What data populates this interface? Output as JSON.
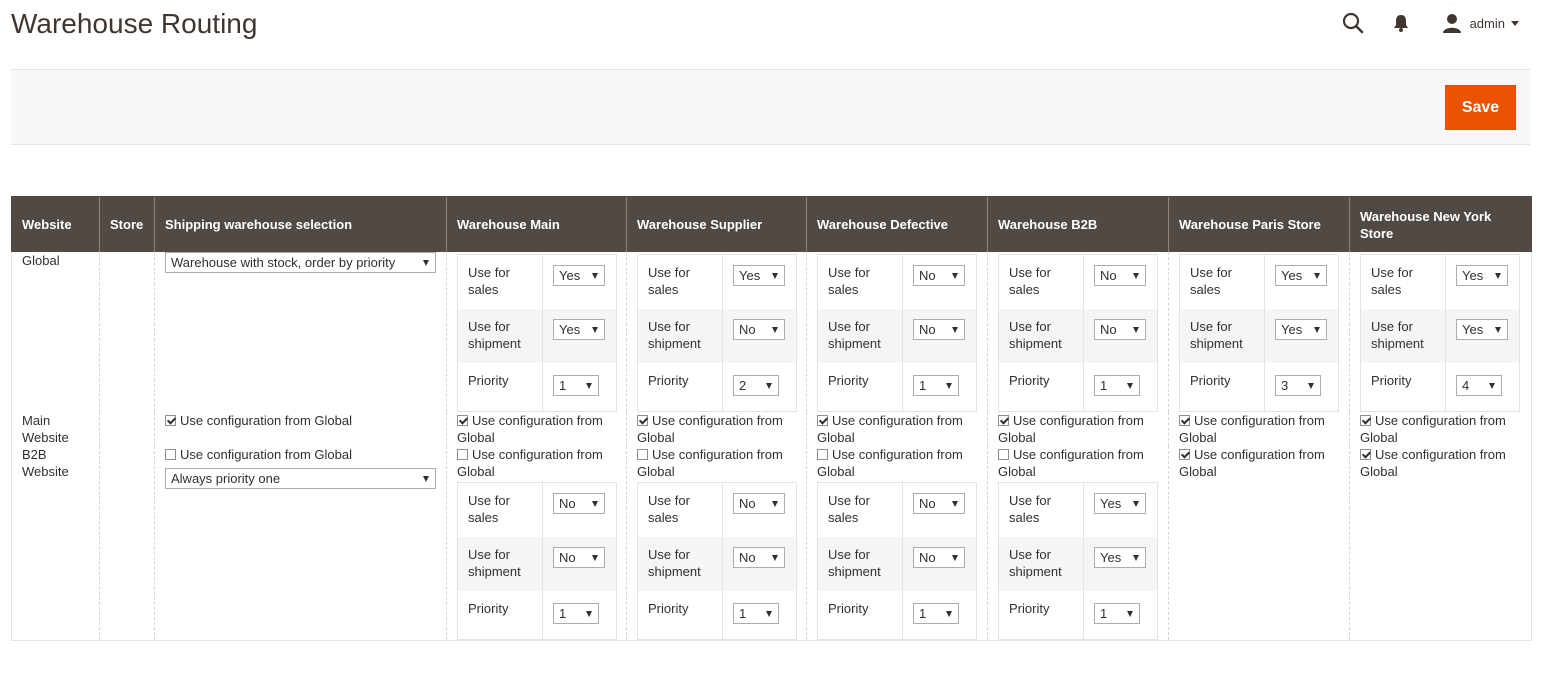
{
  "page": {
    "title": "Warehouse Routing"
  },
  "header": {
    "user": "admin"
  },
  "actions": {
    "save_label": "Save"
  },
  "labels": {
    "use_for_sales": "Use for sales",
    "use_for_shipment": "Use for shipment",
    "priority": "Priority",
    "use_config_global": "Use configuration from Global"
  },
  "columns": [
    "Website",
    "Store",
    "Shipping warehouse selection",
    "Warehouse Main",
    "Warehouse Supplier",
    "Warehouse Defective",
    "Warehouse B2B",
    "Warehouse Paris Store",
    "Warehouse New York Store"
  ],
  "rows": [
    {
      "website": "Global",
      "store": "",
      "shipping": {
        "use_global": null,
        "value": "Warehouse with stock, order by priority"
      },
      "warehouses": [
        {
          "use_global": null,
          "sales": "Yes",
          "shipment": "Yes",
          "priority": "1"
        },
        {
          "use_global": null,
          "sales": "Yes",
          "shipment": "No",
          "priority": "2"
        },
        {
          "use_global": null,
          "sales": "No",
          "shipment": "No",
          "priority": "1"
        },
        {
          "use_global": null,
          "sales": "No",
          "shipment": "No",
          "priority": "1"
        },
        {
          "use_global": null,
          "sales": "Yes",
          "shipment": "Yes",
          "priority": "3"
        },
        {
          "use_global": null,
          "sales": "Yes",
          "shipment": "Yes",
          "priority": "4"
        }
      ]
    },
    {
      "website": "Main Website",
      "store": "",
      "shipping": {
        "use_global": true,
        "value": null
      },
      "warehouses": [
        {
          "use_global": true
        },
        {
          "use_global": true
        },
        {
          "use_global": true
        },
        {
          "use_global": true
        },
        {
          "use_global": true
        },
        {
          "use_global": true
        }
      ]
    },
    {
      "website": "B2B Website",
      "store": "",
      "shipping": {
        "use_global": false,
        "value": "Always priority one"
      },
      "warehouses": [
        {
          "use_global": false,
          "sales": "No",
          "shipment": "No",
          "priority": "1"
        },
        {
          "use_global": false,
          "sales": "No",
          "shipment": "No",
          "priority": "1"
        },
        {
          "use_global": false,
          "sales": "No",
          "shipment": "No",
          "priority": "1"
        },
        {
          "use_global": false,
          "sales": "Yes",
          "shipment": "Yes",
          "priority": "1"
        },
        {
          "use_global": true
        },
        {
          "use_global": true
        }
      ]
    }
  ]
}
